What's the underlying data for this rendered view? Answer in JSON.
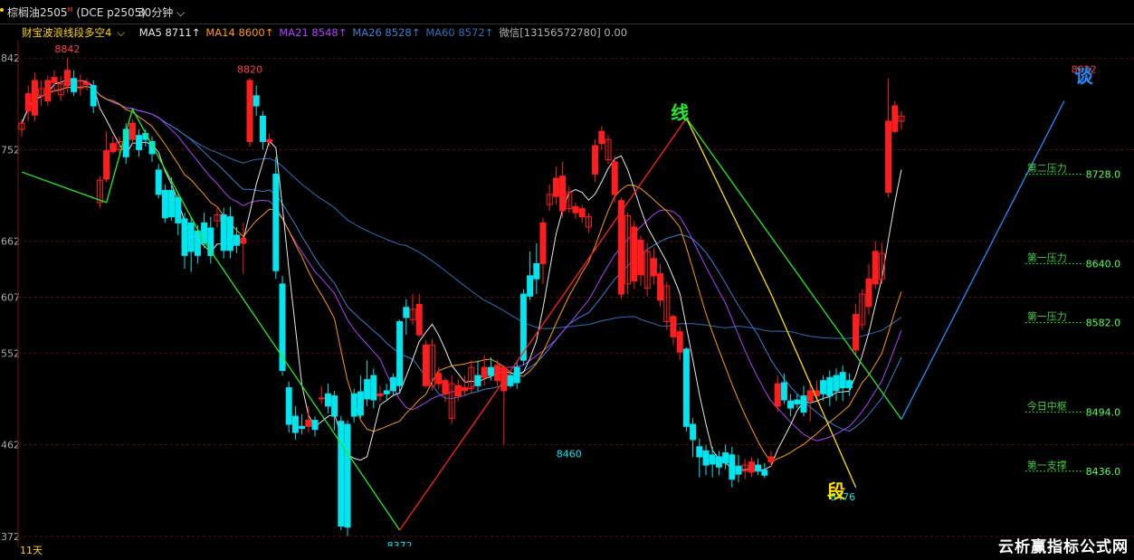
{
  "header": {
    "symbol": "棕榈油2505",
    "symbol_sup": "M",
    "symbol_code": "(DCE p2505)",
    "period": "30分钟"
  },
  "legend": {
    "indicator_name": "财宝波浪线段多空4",
    "items": [
      {
        "text": "MA5 8711↑",
        "color": "#e8e8e8"
      },
      {
        "text": "MA14 8600↑",
        "color": "#ff9900"
      },
      {
        "text": "MA21 8548↑",
        "color": "#b040ff"
      },
      {
        "text": "MA26 8528↑",
        "color": "#3a7fd5"
      },
      {
        "text": "MA60 8572↑",
        "color": "#2a6fb8"
      },
      {
        "text": "微信[13156572780] 0.00",
        "color": "#b0b0b0"
      }
    ]
  },
  "footer": {
    "days": "11天",
    "watermark": "云析赢指标公式网"
  },
  "chart_data": {
    "type": "candlestick",
    "ylim": [
      8362,
      8860
    ],
    "y_ticks": [
      8842,
      8752,
      8662,
      8607,
      8552,
      8462,
      8372
    ],
    "y_tick_labels": [
      "842",
      "752",
      "662",
      "607",
      "552",
      "462",
      "372"
    ],
    "colors": {
      "up": "#ff1e1e",
      "down": "#00e5ee",
      "ma5": "#e8e8e8",
      "ma14": "#ff9900",
      "ma21": "#b040ff",
      "ma26": "#3a7fd5",
      "ma60": "#2a6fb8"
    },
    "candles": [
      [
        8772,
        8778,
        8765,
        8782
      ],
      [
        8790,
        8807,
        8780,
        8815
      ],
      [
        8786,
        8820,
        8780,
        8828
      ],
      [
        8805,
        8812,
        8795,
        8820
      ],
      [
        8800,
        8820,
        8795,
        8825
      ],
      [
        8818,
        8823,
        8808,
        8830
      ],
      [
        8806,
        8817,
        8800,
        8824
      ],
      [
        8815,
        8830,
        8808,
        8842
      ],
      [
        8822,
        8809,
        8805,
        8830
      ],
      [
        8812,
        8820,
        8805,
        8826
      ],
      [
        8816,
        8818,
        8810,
        8822
      ],
      [
        8815,
        8795,
        8788,
        8820
      ],
      [
        8700,
        8722,
        8695,
        8726
      ],
      [
        8723,
        8751,
        8720,
        8770
      ],
      [
        8750,
        8758,
        8748,
        8765
      ],
      [
        8752,
        8760,
        8748,
        8765
      ],
      [
        8772,
        8745,
        8738,
        8778
      ],
      [
        8762,
        8778,
        8758,
        8782
      ],
      [
        8766,
        8752,
        8745,
        8772
      ],
      [
        8768,
        8762,
        8755,
        8772
      ],
      [
        8760,
        8748,
        8740,
        8765
      ],
      [
        8732,
        8708,
        8704,
        8738
      ],
      [
        8712,
        8685,
        8680,
        8718
      ],
      [
        8712,
        8686,
        8682,
        8725
      ],
      [
        8705,
        8680,
        8668,
        8710
      ],
      [
        8684,
        8648,
        8635,
        8690
      ],
      [
        8680,
        8652,
        8632,
        8686
      ],
      [
        8672,
        8648,
        8640,
        8678
      ],
      [
        8680,
        8660,
        8655,
        8690
      ],
      [
        8675,
        8648,
        8640,
        8686
      ],
      [
        8682,
        8688,
        8675,
        8696
      ],
      [
        8688,
        8653,
        8645,
        8695
      ],
      [
        8686,
        8653,
        8645,
        8696
      ],
      [
        8668,
        8658,
        8650,
        8676
      ],
      [
        8660,
        8665,
        8630,
        8680
      ],
      [
        8760,
        8820,
        8755,
        8822
      ],
      [
        8805,
        8795,
        8785,
        8815
      ],
      [
        8785,
        8760,
        8752,
        8790
      ],
      [
        8760,
        8762,
        8755,
        8768
      ],
      [
        8728,
        8633,
        8625,
        8745
      ],
      [
        8620,
        8535,
        8530,
        8628
      ],
      [
        8518,
        8482,
        8474,
        8524
      ],
      [
        8490,
        8474,
        8467,
        8500
      ],
      [
        8480,
        8478,
        8472,
        8492
      ],
      [
        8480,
        8486,
        8474,
        8500
      ],
      [
        8486,
        8477,
        8470,
        8490
      ],
      [
        8507,
        8508,
        8502,
        8520
      ],
      [
        8512,
        8500,
        8493,
        8522
      ],
      [
        8510,
        8490,
        8476,
        8515
      ],
      [
        8485,
        8382,
        8378,
        8490
      ],
      [
        8482,
        8381,
        8372,
        8486
      ],
      [
        8512,
        8490,
        8484,
        8517
      ],
      [
        8514,
        8491,
        8488,
        8530
      ],
      [
        8526,
        8507,
        8500,
        8545
      ],
      [
        8530,
        8506,
        8498,
        8537
      ],
      [
        8510,
        8512,
        8505,
        8520
      ],
      [
        8515,
        8512,
        8506,
        8522
      ],
      [
        8528,
        8515,
        8510,
        8532
      ],
      [
        8583,
        8520,
        8512,
        8585
      ],
      [
        8597,
        8587,
        8570,
        8605
      ],
      [
        8585,
        8595,
        8580,
        8610
      ],
      [
        8570,
        8600,
        8568,
        8610
      ],
      [
        8520,
        8560,
        8518,
        8565
      ],
      [
        8520,
        8560,
        8515,
        8566
      ],
      [
        8522,
        8532,
        8516,
        8538
      ],
      [
        8512,
        8525,
        8504,
        8528
      ],
      [
        8488,
        8522,
        8482,
        8530
      ],
      [
        8510,
        8520,
        8505,
        8526
      ],
      [
        8515,
        8518,
        8510,
        8530
      ],
      [
        8517,
        8538,
        8512,
        8545
      ],
      [
        8530,
        8520,
        8515,
        8545
      ],
      [
        8528,
        8538,
        8520,
        8550
      ],
      [
        8538,
        8530,
        8525,
        8548
      ],
      [
        8525,
        8540,
        8520,
        8545
      ],
      [
        8515,
        8538,
        8462,
        8540
      ],
      [
        8530,
        8520,
        8518,
        8535
      ],
      [
        8538,
        8523,
        8517,
        8545
      ],
      [
        8610,
        8545,
        8540,
        8615
      ],
      [
        8628,
        8608,
        8604,
        8652
      ],
      [
        8640,
        8625,
        8610,
        8660
      ],
      [
        8640,
        8680,
        8620,
        8685
      ],
      [
        8698,
        8708,
        8692,
        8718
      ],
      [
        8706,
        8724,
        8698,
        8735
      ],
      [
        8692,
        8726,
        8685,
        8740
      ],
      [
        8694,
        8710,
        8690,
        8716
      ],
      [
        8690,
        8696,
        8684,
        8700
      ],
      [
        8686,
        8694,
        8680,
        8698
      ],
      [
        8676,
        8686,
        8670,
        8690
      ],
      [
        8728,
        8756,
        8720,
        8762
      ],
      [
        8758,
        8770,
        8752,
        8775
      ],
      [
        8742,
        8762,
        8738,
        8766
      ],
      [
        8708,
        8740,
        8700,
        8746
      ],
      [
        8610,
        8702,
        8605,
        8705
      ],
      [
        8620,
        8687,
        8610,
        8690
      ],
      [
        8623,
        8676,
        8615,
        8682
      ],
      [
        8629,
        8663,
        8618,
        8668
      ],
      [
        8616,
        8652,
        8608,
        8660
      ],
      [
        8628,
        8645,
        8620,
        8655
      ],
      [
        8604,
        8630,
        8598,
        8640
      ],
      [
        8583,
        8618,
        8575,
        8622
      ],
      [
        8568,
        8588,
        8560,
        8590
      ],
      [
        8553,
        8573,
        8545,
        8578
      ],
      [
        8556,
        8480,
        8475,
        8558
      ],
      [
        8482,
        8467,
        8450,
        8488
      ],
      [
        8460,
        8450,
        8430,
        8468
      ],
      [
        8456,
        8442,
        8432,
        8462
      ],
      [
        8452,
        8443,
        8430,
        8460
      ],
      [
        8450,
        8440,
        8432,
        8456
      ],
      [
        8454,
        8444,
        8438,
        8462
      ],
      [
        8452,
        8428,
        8420,
        8460
      ],
      [
        8441,
        8433,
        8425,
        8452
      ],
      [
        8436,
        8442,
        8428,
        8448
      ],
      [
        8435,
        8445,
        8430,
        8450
      ],
      [
        8442,
        8436,
        8432,
        8448
      ],
      [
        8437,
        8432,
        8429,
        8444
      ],
      [
        8445,
        8450,
        8440,
        8456
      ],
      [
        8500,
        8522,
        8494,
        8530
      ],
      [
        8523,
        8506,
        8502,
        8532
      ],
      [
        8505,
        8498,
        8490,
        8512
      ],
      [
        8506,
        8502,
        8498,
        8512
      ],
      [
        8510,
        8494,
        8490,
        8520
      ],
      [
        8505,
        8515,
        8485,
        8525
      ],
      [
        8510,
        8515,
        8505,
        8525
      ],
      [
        8525,
        8512,
        8505,
        8530
      ],
      [
        8528,
        8510,
        8500,
        8535
      ],
      [
        8530,
        8515,
        8505,
        8537
      ],
      [
        8533,
        8518,
        8505,
        8540
      ],
      [
        8525,
        8518,
        8510,
        8532
      ],
      [
        8555,
        8590,
        8550,
        8600
      ],
      [
        8580,
        8610,
        8575,
        8615
      ],
      [
        8598,
        8625,
        8590,
        8640
      ],
      [
        8620,
        8652,
        8615,
        8662
      ],
      [
        8625,
        8650,
        8620,
        8660
      ],
      [
        8710,
        8780,
        8705,
        8822
      ],
      [
        8770,
        8795,
        8768,
        8800
      ],
      [
        8780,
        8785,
        8772,
        8790
      ]
    ],
    "wave_lines": [
      {
        "color": "#22ee22",
        "points": [
          [
            0,
            8730
          ],
          [
            13,
            8700
          ],
          [
            17,
            8792
          ],
          [
            28,
            8662
          ],
          [
            58,
            8378
          ]
        ]
      },
      {
        "color": "#ff2020",
        "points": [
          [
            58,
            8378
          ],
          [
            102,
            8783
          ]
        ]
      },
      {
        "color": "#22ee22",
        "points": [
          [
            102,
            8783
          ],
          [
            135,
            8487
          ]
        ]
      },
      {
        "color": "#ffe000",
        "points": [
          [
            102,
            8783
          ],
          [
            115,
            8610
          ],
          [
            128,
            8420
          ]
        ]
      },
      {
        "color": "#1f8fff",
        "points": [
          [
            135,
            8487
          ],
          [
            160,
            8800
          ]
        ]
      }
    ],
    "annotations": [
      {
        "label": "8842",
        "type": "high",
        "i": 7,
        "y": 8842,
        "color": "#ff4040"
      },
      {
        "label": "8820",
        "type": "high",
        "i": 35,
        "y": 8822,
        "color": "#ff4040"
      },
      {
        "label": "8372",
        "type": "low",
        "i": 58,
        "y": 8372,
        "color": "#00e5ee"
      },
      {
        "label": "8460",
        "type": "low",
        "i": 84,
        "y": 8462,
        "color": "#00e5ee"
      },
      {
        "label": "8476",
        "type": "low",
        "i": 126,
        "y": 8420,
        "color": "#00e5ee"
      },
      {
        "label": "8822",
        "type": "high",
        "i": 163,
        "y": 8822,
        "color": "#ff4040"
      }
    ],
    "text_marks": [
      {
        "text": "线",
        "i": 101,
        "y": 8782,
        "color": "#22ee22"
      },
      {
        "text": "段",
        "i": 125,
        "y": 8410,
        "color": "#ffe000"
      },
      {
        "text": "谈",
        "i": 163,
        "y": 8818,
        "color": "#1f8fff"
      }
    ],
    "levels": [
      {
        "label": "第二压力",
        "value": 8728.0,
        "value_text": "8728.0"
      },
      {
        "label": "第一压力",
        "value": 8640.0,
        "value_text": "8640.0"
      },
      {
        "label": "第一压力",
        "value": 8582.0,
        "value_text": "8582.0"
      },
      {
        "label": "今日中枢",
        "value": 8494.0,
        "value_text": "8494.0"
      },
      {
        "label": "第一支撑",
        "value": 8436.0,
        "value_text": "8436.0"
      }
    ]
  }
}
